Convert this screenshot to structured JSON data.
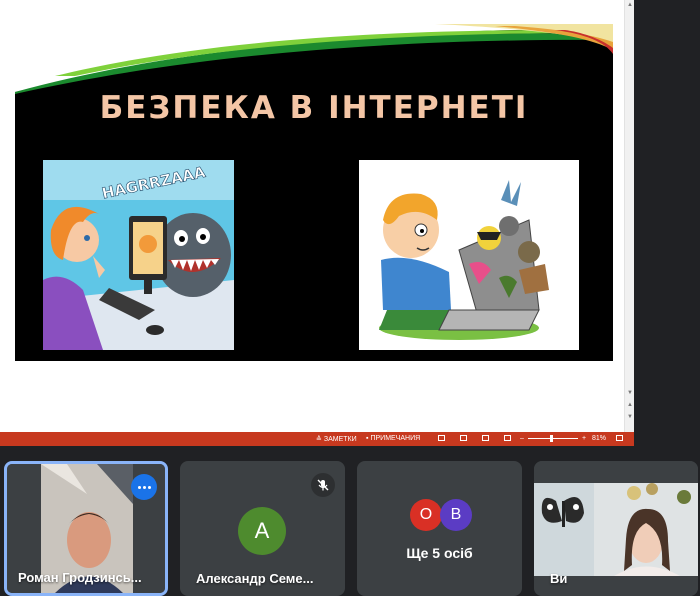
{
  "slide": {
    "title": "БЕЗПЕКА В ІНТЕРНЕТІ",
    "left_image_caption": "HAGRRZAAA",
    "colors": {
      "background": "#000000",
      "title": "#f4c6a6"
    }
  },
  "statusbar": {
    "notes_label": "ЗАМЕТКИ",
    "comments_label": "ПРИМЕЧАНИЯ",
    "zoom_minus": "–",
    "zoom_plus": "+",
    "zoom_level": "81%",
    "color": "#c7391f"
  },
  "participants": [
    {
      "name": "Роман Гродзинсь...",
      "active": true,
      "has_video": true
    },
    {
      "name": "Александр Семе...",
      "avatar_letter": "A",
      "avatar_color": "#4e8b2e",
      "muted": true
    },
    {
      "more_label": "Ще 5 осіб",
      "avatars": [
        {
          "letter": "O",
          "color": "#d93025"
        },
        {
          "letter": "B",
          "color": "#5b3cc4"
        }
      ]
    },
    {
      "name": "Ви",
      "has_video": true
    }
  ]
}
